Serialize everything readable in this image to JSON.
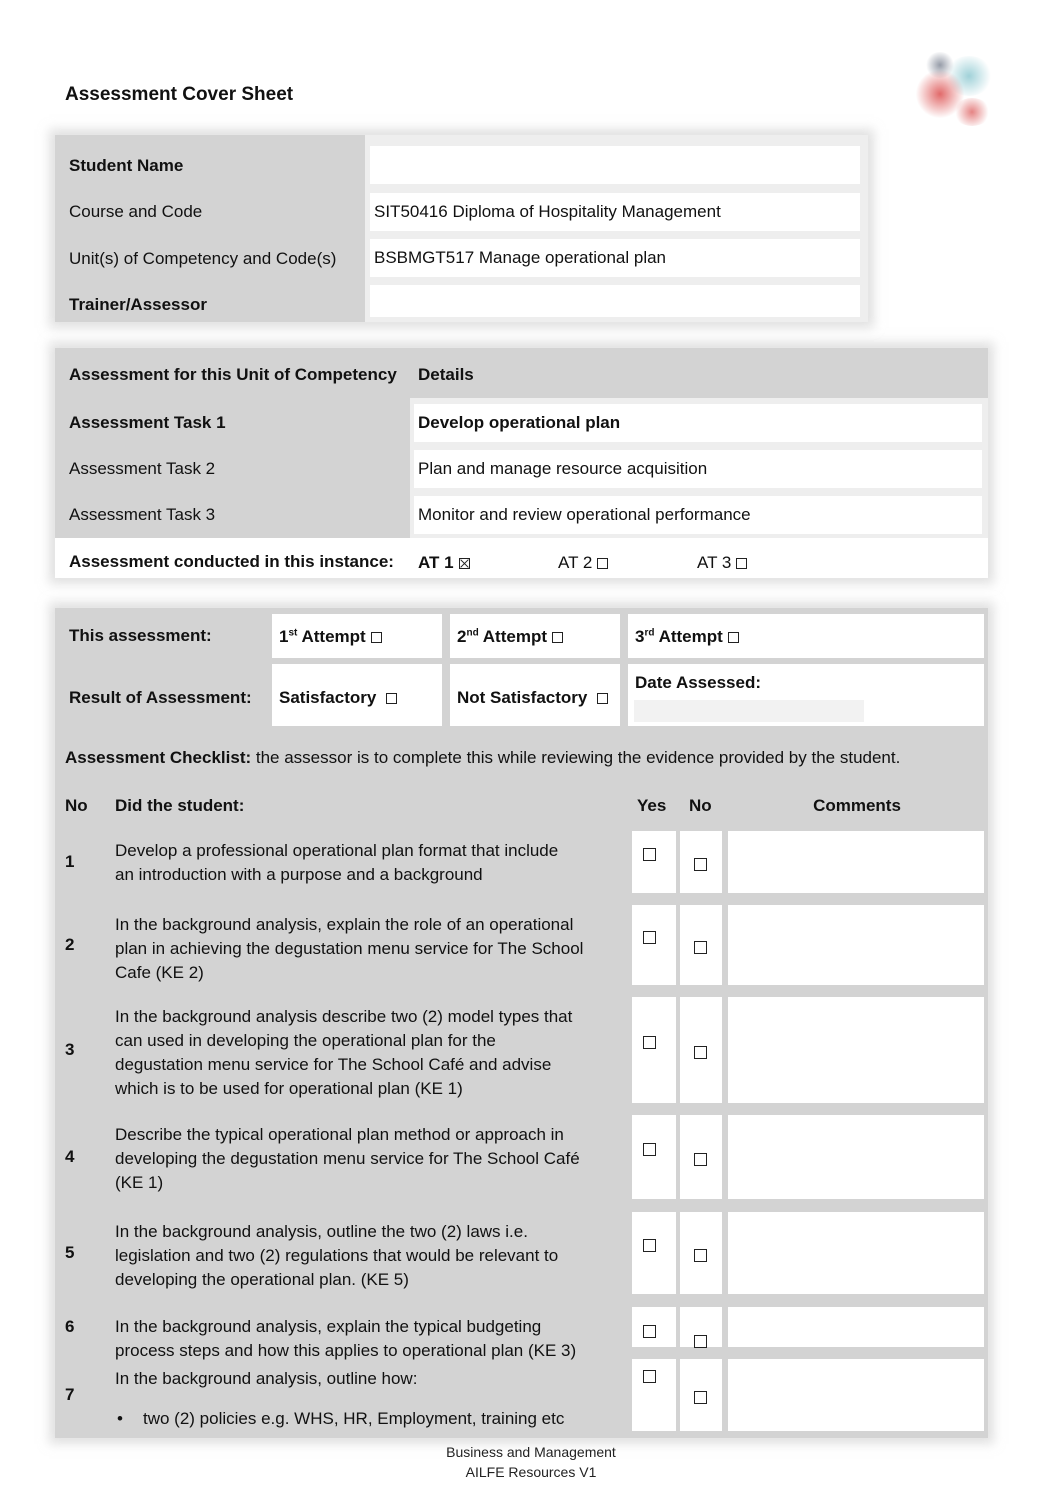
{
  "document": {
    "title": "Assessment Cover Sheet",
    "logo_icon": "organization-logo"
  },
  "student_info": {
    "rows": [
      {
        "label": "Student Name",
        "value": "",
        "bold": true
      },
      {
        "label": "Course and Code",
        "value": "SIT50416 Diploma of Hospitality Management",
        "bold": false
      },
      {
        "label": "Unit(s) of Competency and Code(s)",
        "value": "BSBMGT517 Manage operational plan",
        "bold": false
      },
      {
        "label": "Trainer/Assessor",
        "value": "",
        "bold": true
      }
    ]
  },
  "assessment_tasks": {
    "header_left": "Assessment for this Unit of Competency",
    "header_right": "Details",
    "rows": [
      {
        "label": "Assessment Task 1",
        "detail": "Develop operational plan",
        "bold": true
      },
      {
        "label": "Assessment Task 2",
        "detail": "Plan and manage resource acquisition",
        "bold": false
      },
      {
        "label": "Assessment Task 3",
        "detail": "Monitor and review operational performance",
        "bold": false
      }
    ],
    "conducted_label": "Assessment conducted in this instance:",
    "conducted_options": [
      {
        "label": "AT 1",
        "checked": true
      },
      {
        "label": "AT 2",
        "checked": false
      },
      {
        "label": "AT 3",
        "checked": false
      }
    ]
  },
  "attempt": {
    "label": "This assessment:",
    "options": [
      {
        "num": "1",
        "suffix": "st",
        "label": "Attempt",
        "checked": false
      },
      {
        "num": "2",
        "suffix": "nd",
        "label": "Attempt",
        "checked": false
      },
      {
        "num": "3",
        "suffix": "rd",
        "label": "Attempt",
        "checked": false
      }
    ]
  },
  "result": {
    "label": "Result of Assessment:",
    "options": [
      {
        "label": "Satisfactory",
        "checked": false
      },
      {
        "label": "Not Satisfactory",
        "checked": false
      }
    ],
    "date_label": "Date Assessed:",
    "date_value": ""
  },
  "checklist": {
    "intro_bold": "Assessment Checklist:",
    "intro_text": " the assessor is to complete this while reviewing the evidence provided by the student.",
    "headers": {
      "no": "No",
      "did": "Did the student:",
      "yes": "Yes",
      "no_col": "No",
      "comments": "Comments"
    },
    "items": [
      {
        "no": "1",
        "lines": [
          "Develop  a professional operational plan format that include",
          "an introduction with a purpose and a background"
        ],
        "yes": false,
        "no_checked": false,
        "comment": ""
      },
      {
        "no": "2",
        "lines": [
          "In the background analysis, explain the role of an operational",
          "plan in achieving the degustation menu service for The School",
          "Cafe (KE 2)"
        ],
        "yes": false,
        "no_checked": false,
        "comment": ""
      },
      {
        "no": "3",
        "lines": [
          "In the background analysis describe two (2) model types that",
          "can used in developing the operational plan for the",
          "degustation menu service for The School Café and advise",
          "which is to be used for operational plan (KE 1)"
        ],
        "yes": false,
        "no_checked": false,
        "comment": ""
      },
      {
        "no": "4",
        "lines": [
          "Describe the typical operational plan method or approach in",
          "developing the degustation menu service for The School Café",
          "(KE 1)"
        ],
        "yes": false,
        "no_checked": false,
        "comment": ""
      },
      {
        "no": "5",
        "lines": [
          "In the background analysis, outline the two (2) laws i.e.",
          "legislation and two (2) regulations that would be relevant to",
          "developing the operational plan. (KE 5)"
        ],
        "yes": false,
        "no_checked": false,
        "comment": ""
      },
      {
        "no": "6",
        "lines": [
          "In the background analysis, explain the typical budgeting",
          "process steps and how this applies to operational plan (KE 3)"
        ],
        "yes": false,
        "no_checked": false,
        "comment": ""
      },
      {
        "no": "7",
        "lines": [
          "In the background analysis, outline how:"
        ],
        "bullets": [
          "two (2) policies e.g. WHS, HR, Employment, training etc"
        ],
        "yes": false,
        "no_checked": false,
        "comment": ""
      }
    ]
  },
  "footer": {
    "line1": "Business and Management",
    "line2": "AILFE Resources V1"
  }
}
